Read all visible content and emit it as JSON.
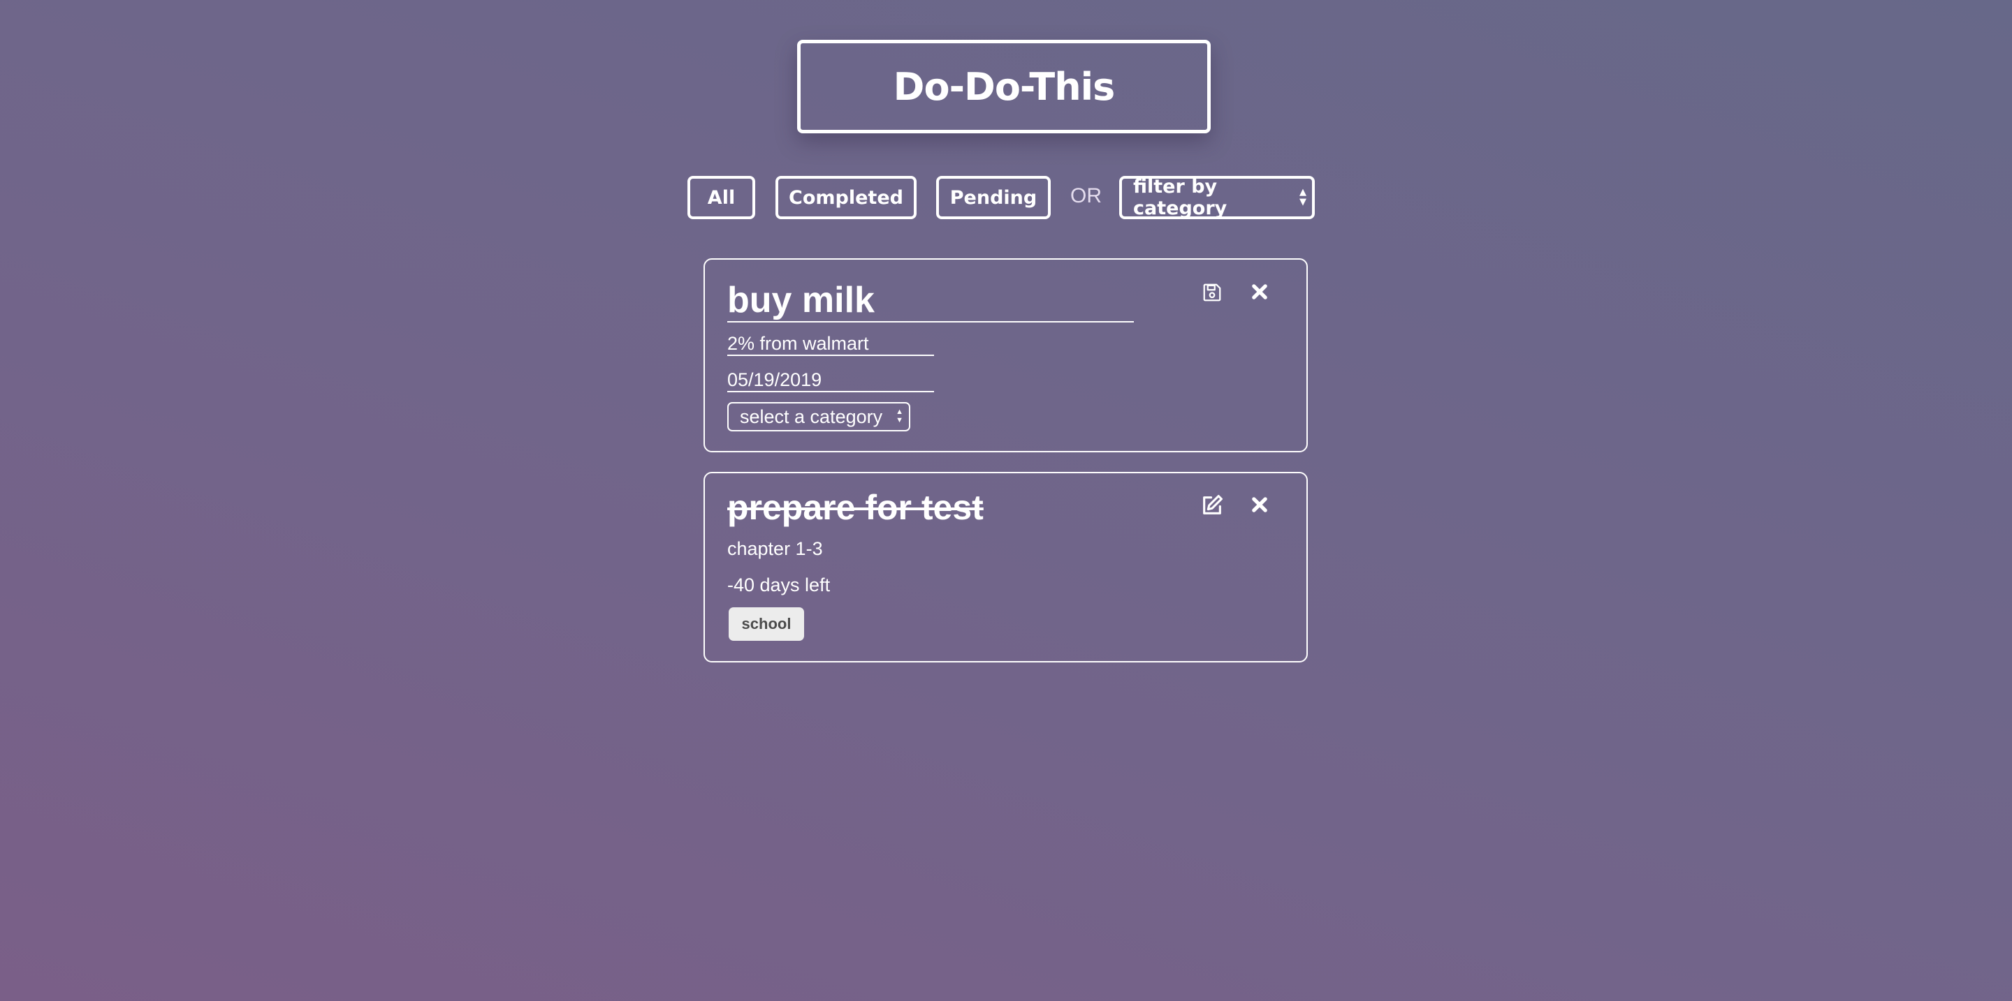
{
  "header": {
    "title": "Do-Do-This"
  },
  "filters": {
    "all_label": "All",
    "completed_label": "Completed",
    "pending_label": "Pending",
    "or_text": "OR",
    "category_select": "filter by category"
  },
  "todos": [
    {
      "title": "buy milk",
      "description": "2% from walmart",
      "date": "05/19/2019",
      "category_select": "select a category",
      "mode": "editing",
      "action_icon": "save-icon",
      "delete_icon": "close-icon"
    },
    {
      "title": "prepare for test",
      "description": "chapter 1-3",
      "days_left": "-40 days left",
      "category": "school",
      "completed": true,
      "action_icon": "edit-icon",
      "delete_icon": "close-icon"
    }
  ],
  "colors": {
    "text": "#ffffff",
    "tag_background": "#ececec",
    "tag_text": "#4b4b4b",
    "background_start": "#7a5f88",
    "background_end": "#676889"
  }
}
